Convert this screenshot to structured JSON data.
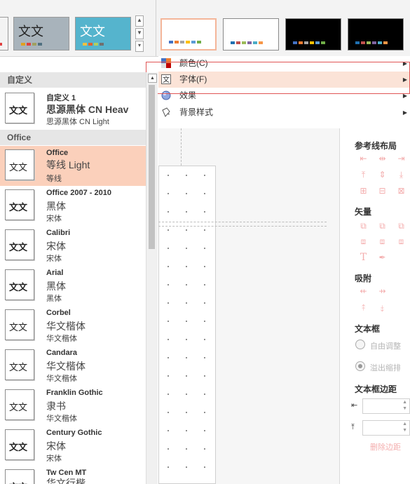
{
  "ribbon": {
    "themes": [
      {
        "glyph": "",
        "bg": "#c0c5c9",
        "bars": [
          "#e04040",
          "#f0b030",
          "#ffffff",
          "#e0a020"
        ]
      },
      {
        "glyph": "文文",
        "bg": "#a8b3bb",
        "bars": [
          "#e0a020",
          "#e04040",
          "#a0a060",
          "#507080"
        ]
      },
      {
        "glyph": "文文",
        "bg": "#55b4cd",
        "bars": [
          "#f0c040",
          "#e06030",
          "#b0d060",
          "#707070"
        ]
      }
    ],
    "variants": [
      {
        "bg": "#ffffff",
        "bars": [
          "#4472c4",
          "#ed7d31",
          "#a5a5a5",
          "#ffc000",
          "#5b9bd5",
          "#70ad47"
        ]
      },
      {
        "bg": "#ffffff",
        "bars": [
          "#1f6fb0",
          "#c0504d",
          "#9bbb59",
          "#8064a2",
          "#4bacc6",
          "#f79646"
        ]
      },
      {
        "bg": "#000000",
        "bars": [
          "#4472c4",
          "#ed7d31",
          "#a5a5a5",
          "#ffc000",
          "#5b9bd5",
          "#70ad47"
        ]
      },
      {
        "bg": "#000000",
        "bars": [
          "#1f6fb0",
          "#c0504d",
          "#9bbb59",
          "#8064a2",
          "#4bacc6",
          "#f79646"
        ]
      }
    ]
  },
  "menu": {
    "items": [
      {
        "label": "颜色(C)",
        "icon": "color-palette-icon"
      },
      {
        "label": "字体(F)",
        "icon": "font-icon"
      },
      {
        "label": "效果",
        "icon": "effects-icon"
      },
      {
        "label": "背景样式",
        "icon": "background-style-icon"
      }
    ]
  },
  "fonts": {
    "custom_header": "自定义",
    "custom": {
      "name": "自定义 1",
      "heading": "思源黑体 CN Heav",
      "body": "思源黑体 CN Light",
      "thumb": "文文"
    },
    "office_header": "Office",
    "items": [
      {
        "name": "Office",
        "heading": "等线 Light",
        "body": "等线",
        "thumb": "文文"
      },
      {
        "name": "Office 2007 - 2010",
        "heading": "黑体",
        "body": "宋体",
        "thumb": "文文"
      },
      {
        "name": "Calibri",
        "heading": "宋体",
        "body": "宋体",
        "thumb": "文文"
      },
      {
        "name": "Arial",
        "heading": "黑体",
        "body": "黑体",
        "thumb": "文文"
      },
      {
        "name": "Corbel",
        "heading": "华文楷体",
        "body": "华文楷体",
        "thumb": "文文"
      },
      {
        "name": "Candara",
        "heading": "华文楷体",
        "body": "华文楷体",
        "thumb": "文文"
      },
      {
        "name": "Franklin Gothic",
        "heading": "隶书",
        "body": "华文楷体",
        "thumb": "文文"
      },
      {
        "name": "Century Gothic",
        "heading": "宋体",
        "body": "宋体",
        "thumb": "文文"
      },
      {
        "name": "Tw Cen MT",
        "heading": "华文行楷",
        "body": "",
        "thumb": "文文"
      }
    ]
  },
  "right_pane": {
    "guides_title": "参考线布局",
    "vector_title": "矢量",
    "snap_title": "吸附",
    "textbox_title": "文本框",
    "autofit_label": "自由调整",
    "overflow_label": "溢出缩排",
    "margin_title": "文本框边距",
    "delete_margin": "删除边距",
    "accent": "#f4aeae"
  }
}
